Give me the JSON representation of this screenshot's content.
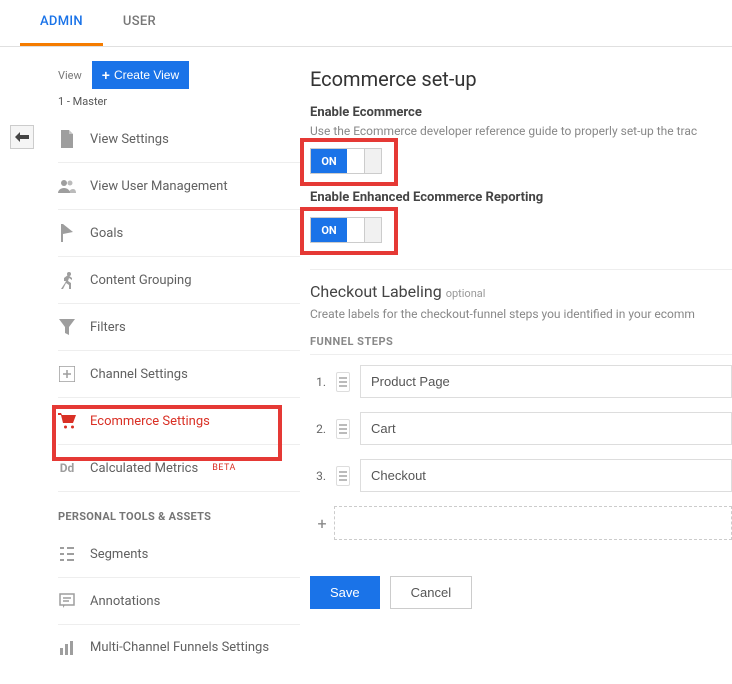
{
  "tabs": {
    "admin": "ADMIN",
    "user": "USER"
  },
  "view": {
    "label": "View",
    "create": "Create View",
    "master": "1 - Master"
  },
  "sidebar": {
    "items": [
      {
        "label": "View Settings"
      },
      {
        "label": "View User Management"
      },
      {
        "label": "Goals"
      },
      {
        "label": "Content Grouping"
      },
      {
        "label": "Filters"
      },
      {
        "label": "Channel Settings"
      },
      {
        "label": "Ecommerce Settings"
      },
      {
        "label": "Calculated Metrics",
        "badge": "BETA"
      }
    ],
    "personal_header": "PERSONAL TOOLS & ASSETS",
    "personal": [
      {
        "label": "Segments"
      },
      {
        "label": "Annotations"
      },
      {
        "label": "Multi-Channel Funnels Settings"
      }
    ]
  },
  "page": {
    "title": "Ecommerce set-up",
    "enable_label": "Enable Ecommerce",
    "enable_help": "Use the Ecommerce developer reference guide to properly set-up the trac",
    "enhanced_label": "Enable Enhanced Ecommerce Reporting",
    "toggle_on": "ON",
    "checkout_title": "Checkout Labeling",
    "optional": "optional",
    "checkout_help": "Create labels for the checkout-funnel steps you identified in your ecomm",
    "funnel_header": "FUNNEL STEPS",
    "steps": [
      {
        "num": "1.",
        "label": "Product Page"
      },
      {
        "num": "2.",
        "label": "Cart"
      },
      {
        "num": "3.",
        "label": "Checkout"
      }
    ],
    "add": "+",
    "save": "Save",
    "cancel": "Cancel"
  }
}
